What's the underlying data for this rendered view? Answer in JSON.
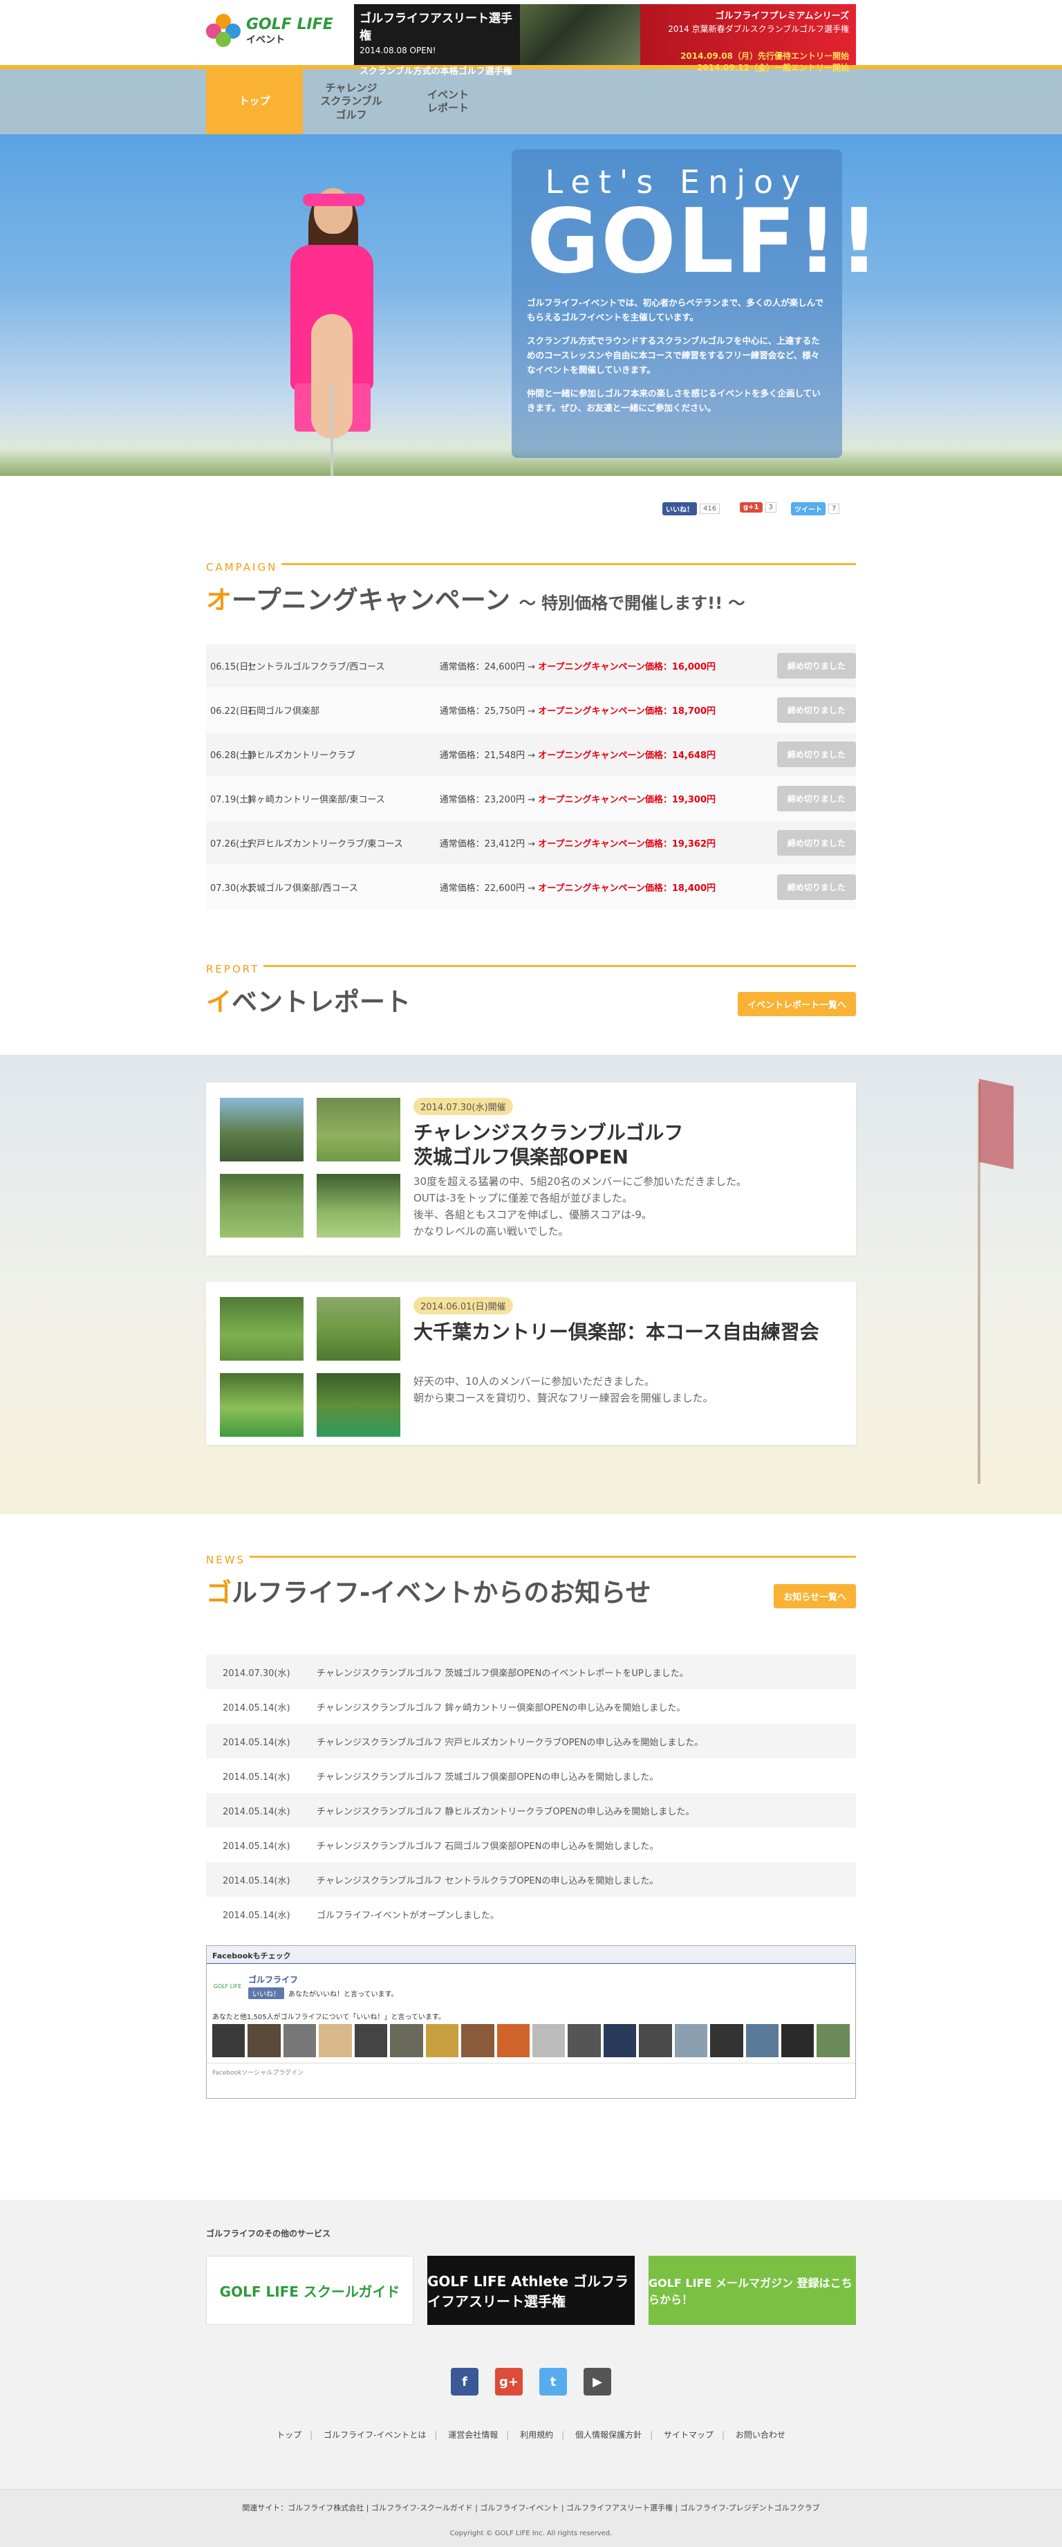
{
  "header": {
    "logo_main": "GOLF LIFE",
    "logo_sub": "イベント",
    "banner1": {
      "title": "ゴルフライフアスリート選手権",
      "open": "2014.08.08 OPEN!",
      "desc": "スクランブル方式の本格ゴルフ選手権"
    },
    "banner2": {
      "title": "ゴルフライフプレミアムシリーズ",
      "sub": "2014 京葉新春ダブルスクランブルゴルフ選手権",
      "line1": "2014.09.08（月）先行優待エントリー開始",
      "line2": "2014.09.12（金）一般エントリー開始"
    }
  },
  "nav": {
    "items": [
      {
        "label": "トップ"
      },
      {
        "label": "チャレンジ\nスクランブル\nゴルフ"
      },
      {
        "label": "イベント\nレポート"
      }
    ]
  },
  "hero": {
    "lets": "Let's Enjoy",
    "golf": "GOLF!!",
    "p1": "ゴルフライフ-イベントでは、初心者からベテランまで、多くの人が楽しんでもらえるゴルフイベントを主催しています。",
    "p2": "スクランブル方式でラウンドするスクランブルゴルフを中心に、上達するためのコースレッスンや自由に本コースで練習をするフリー練習会など、様々なイベントを開催していきます。",
    "p3": "仲間と一緒に参加しゴルフ本来の楽しさを感じるイベントを多く企画していきます。ぜひ、お友達と一緒にご参加ください。"
  },
  "share": {
    "fb_label": "いいね！",
    "fb_count": "416",
    "gp_label": "g+1",
    "gp_count": "3",
    "tw_label": "ツイート",
    "tw_count": "7"
  },
  "campaign": {
    "eng": "CAMPAIGN",
    "title_first": "オ",
    "title_rest": "ープニングキャンペーン",
    "title_sub": "～ 特別価格で開催します!! ～",
    "rows": [
      {
        "date": "06.15(日)",
        "name": "セントラルゴルフクラブ/西コース",
        "normal": "通常価格：24,600円 →",
        "special": "オープニングキャンペーン価格：16,000円",
        "status": "締め切りました"
      },
      {
        "date": "06.22(日)",
        "name": "石岡ゴルフ倶楽部",
        "normal": "通常価格：25,750円 →",
        "special": "オープニングキャンペーン価格：18,700円",
        "status": "締め切りました"
      },
      {
        "date": "06.28(土)",
        "name": "静ヒルズカントリークラブ",
        "normal": "通常価格：21,548円 →",
        "special": "オープニングキャンペーン価格：14,648円",
        "status": "締め切りました"
      },
      {
        "date": "07.19(土)",
        "name": "鉾ヶ崎カントリー倶楽部/東コース",
        "normal": "通常価格：23,200円 →",
        "special": "オープニングキャンペーン価格：19,300円",
        "status": "締め切りました"
      },
      {
        "date": "07.26(土)",
        "name": "宍戸ヒルズカントリークラブ/東コース",
        "normal": "通常価格：23,412円 →",
        "special": "オープニングキャンペーン価格：19,362円",
        "status": "締め切りました"
      },
      {
        "date": "07.30(水)",
        "name": "茨城ゴルフ倶楽部/西コース",
        "normal": "通常価格：22,600円 →",
        "special": "オープニングキャンペーン価格：18,400円",
        "status": "締め切りました"
      }
    ]
  },
  "report": {
    "eng": "REPORT",
    "title_first": "イ",
    "title_rest": "ベントレポート",
    "more": "イベントレポート一覧へ",
    "cards": [
      {
        "date": "2014.07.30(水)開催",
        "title1": "チャレンジスクランブルゴルフ",
        "title2": "茨城ゴルフ倶楽部OPEN",
        "text": "30度を超える猛暑の中、5組20名のメンバーにご参加いただきました。\nOUTは-3をトップに僅差で各組が並びました。\n後半、各組ともスコアを伸ばし、優勝スコアは-9。\nかなりレベルの高い戦いでした。"
      },
      {
        "date": "2014.06.01(日)開催",
        "title1": "大千葉カントリー倶楽部：本コース自由練習会",
        "title2": "",
        "text": "好天の中、10人のメンバーに参加いただきました。\n朝から東コースを貸切り、贅沢なフリー練習会を開催しました。"
      }
    ]
  },
  "news": {
    "eng": "NEWS",
    "title_first": "ゴ",
    "title_rest": "ルフライフ-イベントからのお知らせ",
    "more": "お知らせ一覧へ",
    "items": [
      {
        "date": "2014.07.30(水)",
        "text": "チャレンジスクランブルゴルフ 茨城ゴルフ倶楽部OPENのイベントレポートをUPしました。"
      },
      {
        "date": "2014.05.14(水)",
        "text": "チャレンジスクランブルゴルフ 鉾ヶ崎カントリー倶楽部OPENの申し込みを開始しました。"
      },
      {
        "date": "2014.05.14(水)",
        "text": "チャレンジスクランブルゴルフ 宍戸ヒルズカントリークラブOPENの申し込みを開始しました。"
      },
      {
        "date": "2014.05.14(水)",
        "text": "チャレンジスクランブルゴルフ 茨城ゴルフ倶楽部OPENの申し込みを開始しました。"
      },
      {
        "date": "2014.05.14(水)",
        "text": "チャレンジスクランブルゴルフ 静ヒルズカントリークラブOPENの申し込みを開始しました。"
      },
      {
        "date": "2014.05.14(水)",
        "text": "チャレンジスクランブルゴルフ 石岡ゴルフ倶楽部OPENの申し込みを開始しました。"
      },
      {
        "date": "2014.05.14(水)",
        "text": "チャレンジスクランブルゴルフ セントラルクラブOPENの申し込みを開始しました。"
      },
      {
        "date": "2014.05.14(水)",
        "text": "ゴルフライフ-イベントがオープンしました。"
      }
    ]
  },
  "facebook": {
    "head": "Facebookもチェック",
    "page": "ゴルフライフ",
    "logo": "GOLF LIFE",
    "like": "いいね！",
    "you_like": "あなたがいいね！と言っています。",
    "count_text": "あなたと他1,505人がゴルフライフについて「いいね！」と言っています。",
    "foot": "Facebookソーシャルプラグイン"
  },
  "footer": {
    "services_title": "ゴルフライフのその他のサービス",
    "svc1": "GOLF LIFE スクールガイド",
    "svc2": "GOLF LIFE Athlete ゴルフライフアスリート選手権",
    "svc3": "GOLF LIFE メールマガジン 登録はこちらから！",
    "sns": {
      "facebook": "f",
      "gplus": "g+",
      "twitter": "t",
      "youtube": "▶"
    },
    "links": [
      "トップ",
      "ゴルフライフ-イベントとは",
      "運営会社情報",
      "利用規約",
      "個人情報保護方針",
      "サイトマップ",
      "お問い合わせ"
    ],
    "related": "関連サイト：ゴルフライフ株式会社 | ゴルフライフ-スクールガイド | ゴルフライフ-イベント | ゴルフライフアスリート選手権 | ゴルフライフ-プレジデントゴルフクラブ",
    "copyright": "Copyright © GOLF LIFE Inc. All rights reserved."
  },
  "colors": {
    "accent": "#f7b733",
    "accent_dark": "#f39c12",
    "red": "#e60012",
    "nav_bg": "#a9c2d1",
    "hero_sky": "#5aa3e3"
  }
}
